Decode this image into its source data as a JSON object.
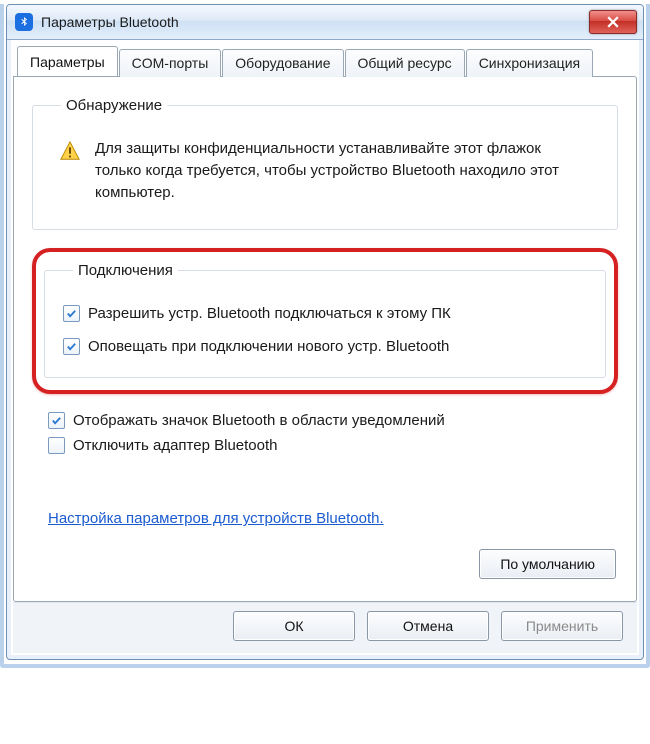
{
  "title": "Параметры Bluetooth",
  "tabs": {
    "params": "Параметры",
    "com": "COM-порты",
    "hardware": "Оборудование",
    "share": "Общий ресурс",
    "sync": "Синхронизация"
  },
  "group_discovery": {
    "legend": "Обнаружение",
    "warning": "Для защиты конфиденциальности устанавливайте этот флажок только когда требуется, чтобы устройство Bluetooth находило этот компьютер."
  },
  "group_connections": {
    "legend": "Подключения",
    "allow": "Разрешить устр. Bluetooth подключаться к этому ПК",
    "notify": "Оповещать при подключении нового устр. Bluetooth"
  },
  "checks": {
    "tray": "Отображать значок Bluetooth в области уведомлений",
    "disable_adapter": "Отключить адаптер Bluetooth"
  },
  "link": "Настройка параметров для устройств Bluetooth.",
  "buttons": {
    "defaults": "По умолчанию",
    "ok": "ОК",
    "cancel": "Отмена",
    "apply": "Применить"
  }
}
